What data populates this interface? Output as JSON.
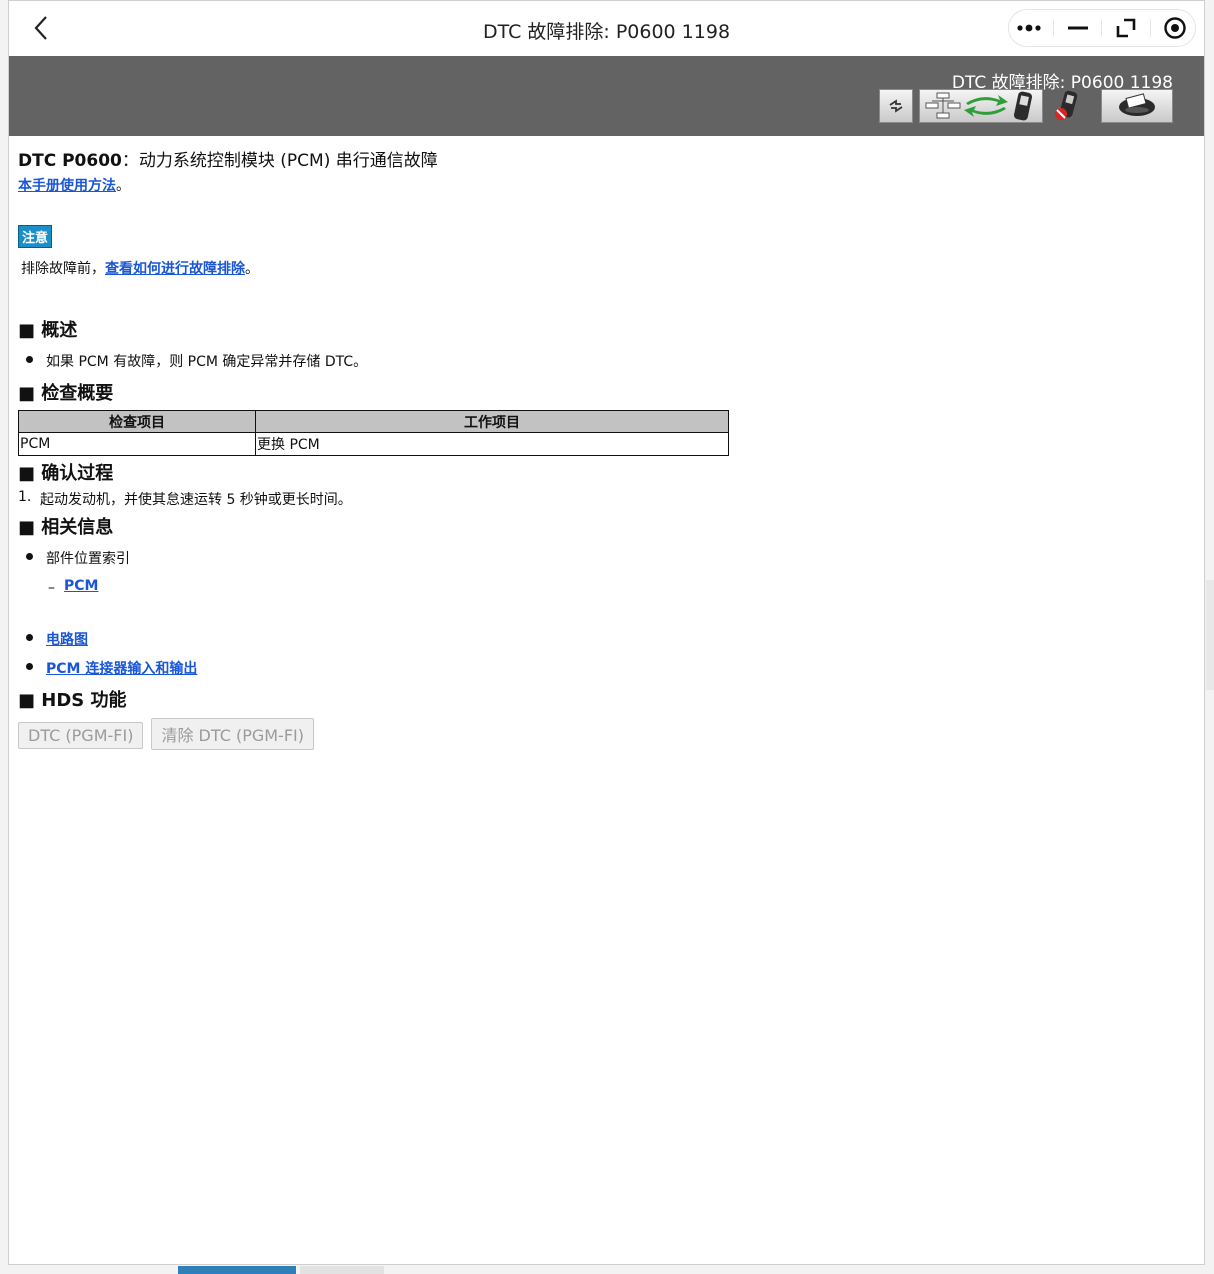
{
  "window": {
    "title": "DTC 故障排除: P0600 1198"
  },
  "header": {
    "title": "DTC 故障排除: P0600 1198",
    "toolbar_icons": [
      "refresh-icon",
      "flowchart-icon",
      "sync-arrows-icon",
      "scan-tool-icon",
      "scan-tool-disabled-icon",
      "printer-icon"
    ]
  },
  "content": {
    "dtc_code": "DTC P0600",
    "dtc_desc": "：动力系统控制模块 (PCM) 串行通信故障",
    "manual_link": "本手册使用方法",
    "manual_suffix": "。",
    "note_badge": "注意",
    "note_prefix": "排除故障前，",
    "note_link": "查看如何进行故障排除",
    "note_suffix": "。",
    "overview": {
      "heading": "■ 概述",
      "items": [
        "如果 PCM 有故障，则 PCM 确定异常并存储 DTC。"
      ]
    },
    "inspection": {
      "heading": "■ 检查概要",
      "columns": [
        "检查项目",
        "工作项目"
      ],
      "rows": [
        [
          "PCM",
          "更换 PCM"
        ]
      ]
    },
    "confirm": {
      "heading": "■ 确认过程",
      "steps": [
        {
          "num": "1.",
          "text": "起动发动机，并使其怠速运转 5 秒钟或更长时间。"
        }
      ]
    },
    "related": {
      "heading": "■ 相关信息",
      "component_index": "部件位置索引",
      "dash": "–",
      "pcm_link": "PCM",
      "circuit_link": "电路图",
      "connector_link": "PCM 连接器输入和输出"
    },
    "hds": {
      "heading": "■ HDS 功能",
      "btn_dtc": "DTC (PGM-FI)",
      "btn_clear": "清除 DTC (PGM-FI)"
    }
  }
}
